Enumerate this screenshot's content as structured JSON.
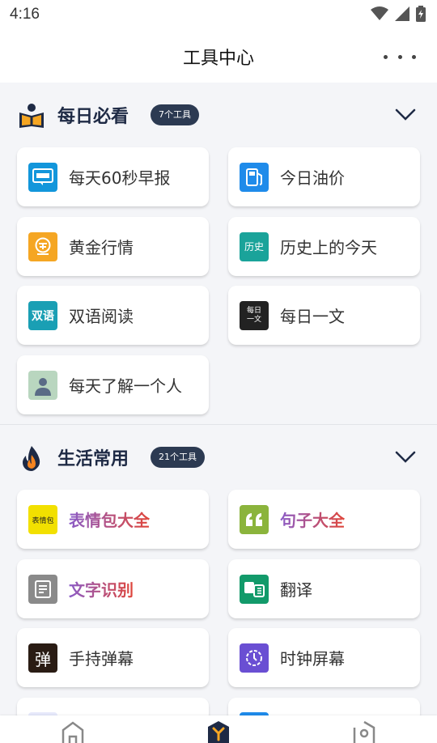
{
  "status": {
    "time": "4:16"
  },
  "header": {
    "title": "工具中心"
  },
  "sections": [
    {
      "title": "每日必看",
      "badge": "7个工具",
      "items": [
        {
          "label": "每天60秒早报",
          "icon": "news-icon",
          "color": "#1296db"
        },
        {
          "label": "今日油价",
          "icon": "fuel-icon",
          "color": "#1f8bea"
        },
        {
          "label": "黄金行情",
          "icon": "gold-icon",
          "color": "#f5a623"
        },
        {
          "label": "历史上的今天",
          "icon": "history-icon",
          "icon_text": "历史",
          "color": "#1aa39a"
        },
        {
          "label": "双语阅读",
          "icon": "bilingual-icon",
          "icon_text": "双语",
          "color": "#1a9fb4"
        },
        {
          "label": "每日一文",
          "icon": "article-icon",
          "icon_text": "每日一文",
          "color": "#222222"
        },
        {
          "label": "每天了解一个人",
          "icon": "person-icon",
          "color": "#b9d6bf"
        }
      ]
    },
    {
      "title": "生活常用",
      "badge": "21个工具",
      "items": [
        {
          "label": "表情包大全",
          "icon": "sticker-icon",
          "icon_text": "表情包",
          "color": "#f2e000"
        },
        {
          "label": "句子大全",
          "icon": "quote-icon",
          "color": "#8bb43c"
        },
        {
          "label": "文字识别",
          "icon": "ocr-icon",
          "color": "#8a8a8a"
        },
        {
          "label": "翻译",
          "icon": "translate-icon",
          "color": "#129a6a"
        },
        {
          "label": "手持弹幕",
          "icon": "danmaku-icon",
          "icon_text": "弹",
          "color": "#2a1c14"
        },
        {
          "label": "时钟屏幕",
          "icon": "clock-icon",
          "color": "#6a4fd3"
        }
      ]
    }
  ],
  "colors": {
    "accent": "#2c3a52",
    "page_bg": "#f4f5f8"
  }
}
